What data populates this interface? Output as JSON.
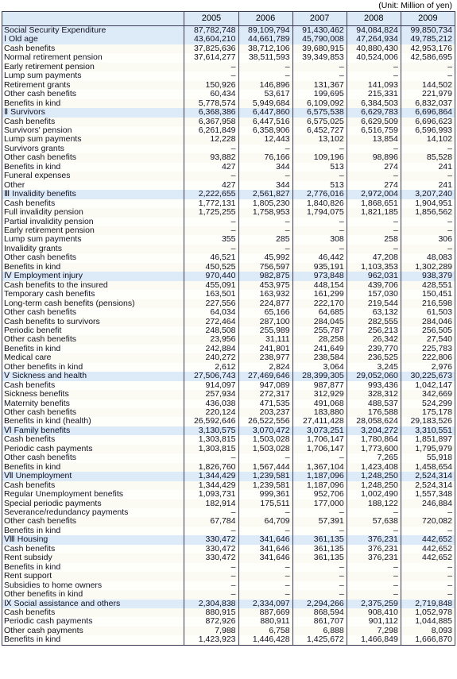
{
  "unit_note": "(Unit: Million of yen)",
  "table": {
    "label_header": "",
    "year_headers": [
      "2005",
      "2006",
      "2007",
      "2008",
      "2009"
    ],
    "rows": [
      {
        "label": "Social Security Expenditure",
        "indent": 0,
        "highlight": true,
        "values": [
          "87,782,748",
          "89,109,794",
          "91,430,462",
          "94,084,824",
          "99,850,734"
        ]
      },
      {
        "label": "Ⅰ Old age",
        "indent": 1,
        "highlight": true,
        "values": [
          "43,604,210",
          "44,661,789",
          "45,790,008",
          "47,264,934",
          "49,785,212"
        ]
      },
      {
        "label": "Cash benefits",
        "indent": 2,
        "highlight": false,
        "values": [
          "37,825,636",
          "38,712,106",
          "39,680,915",
          "40,880,430",
          "42,953,176"
        ]
      },
      {
        "label": "Normal retirement pension",
        "indent": 3,
        "highlight": false,
        "values": [
          "37,614,277",
          "38,511,593",
          "39,349,853",
          "40,524,006",
          "42,586,695"
        ]
      },
      {
        "label": "Early retirement pension",
        "indent": 3,
        "highlight": false,
        "values": [
          "–",
          "–",
          "–",
          "–",
          "–"
        ]
      },
      {
        "label": "Lump sum payments",
        "indent": 3,
        "highlight": false,
        "values": [
          "–",
          "–",
          "–",
          "–",
          "–"
        ]
      },
      {
        "label": "Retirement grants",
        "indent": 3,
        "highlight": false,
        "values": [
          "150,926",
          "146,896",
          "131,367",
          "141,093",
          "144,502"
        ]
      },
      {
        "label": "Other cash benefits",
        "indent": 3,
        "highlight": false,
        "values": [
          "60,434",
          "53,617",
          "199,695",
          "215,331",
          "221,979"
        ]
      },
      {
        "label": "Benefits in kind",
        "indent": 2,
        "highlight": false,
        "values": [
          "5,778,574",
          "5,949,684",
          "6,109,092",
          "6,384,503",
          "6,832,037"
        ]
      },
      {
        "label": "Ⅱ Survivors",
        "indent": 1,
        "highlight": true,
        "values": [
          "6,368,386",
          "6,447,860",
          "6,575,538",
          "6,629,783",
          "6,696,864"
        ]
      },
      {
        "label": "Cash benefits",
        "indent": 2,
        "highlight": false,
        "values": [
          "6,367,958",
          "6,447,516",
          "6,575,025",
          "6,629,509",
          "6,696,623"
        ]
      },
      {
        "label": "Survivors' pension",
        "indent": 3,
        "highlight": false,
        "values": [
          "6,261,849",
          "6,358,906",
          "6,452,727",
          "6,516,759",
          "6,596,993"
        ]
      },
      {
        "label": "Lump sum payments",
        "indent": 3,
        "highlight": false,
        "values": [
          "12,228",
          "12,443",
          "13,102",
          "13,854",
          "14,102"
        ]
      },
      {
        "label": "Survivors grants",
        "indent": 3,
        "highlight": false,
        "values": [
          "–",
          "–",
          "–",
          "–",
          "–"
        ]
      },
      {
        "label": "Other cash benefits",
        "indent": 3,
        "highlight": false,
        "values": [
          "93,882",
          "76,166",
          "109,196",
          "98,896",
          "85,528"
        ]
      },
      {
        "label": "Benefits in kind",
        "indent": 2,
        "highlight": false,
        "values": [
          "427",
          "344",
          "513",
          "274",
          "241"
        ]
      },
      {
        "label": "Funeral expenses",
        "indent": 3,
        "highlight": false,
        "values": [
          "–",
          "–",
          "–",
          "–",
          "–"
        ]
      },
      {
        "label": "Other",
        "indent": 3,
        "highlight": false,
        "values": [
          "427",
          "344",
          "513",
          "274",
          "241"
        ]
      },
      {
        "label": "Ⅲ Invalidity benefits",
        "indent": 1,
        "highlight": true,
        "values": [
          "2,222,655",
          "2,561,827",
          "2,776,016",
          "2,972,004",
          "3,207,240"
        ]
      },
      {
        "label": "Cash benefits",
        "indent": 2,
        "highlight": false,
        "values": [
          "1,772,131",
          "1,805,230",
          "1,840,826",
          "1,868,651",
          "1,904,951"
        ]
      },
      {
        "label": "Full invalidity pension",
        "indent": 3,
        "highlight": false,
        "values": [
          "1,725,255",
          "1,758,953",
          "1,794,075",
          "1,821,185",
          "1,856,562"
        ]
      },
      {
        "label": "Partial invalidity pension",
        "indent": 3,
        "highlight": false,
        "values": [
          "–",
          "–",
          "–",
          "–",
          "–"
        ]
      },
      {
        "label": "Early retirement pension",
        "indent": 3,
        "highlight": false,
        "values": [
          "–",
          "–",
          "–",
          "–",
          "–"
        ]
      },
      {
        "label": "Lump sum payments",
        "indent": 3,
        "highlight": false,
        "values": [
          "355",
          "285",
          "308",
          "258",
          "306"
        ]
      },
      {
        "label": "Invalidity grants",
        "indent": 3,
        "highlight": false,
        "values": [
          "–",
          "–",
          "–",
          "–",
          "–"
        ]
      },
      {
        "label": "Other cash benefits",
        "indent": 3,
        "highlight": false,
        "values": [
          "46,521",
          "45,992",
          "46,442",
          "47,208",
          "48,083"
        ]
      },
      {
        "label": "Benefits in kind",
        "indent": 2,
        "highlight": false,
        "values": [
          "450,525",
          "756,597",
          "935,191",
          "1,103,353",
          "1,302,289"
        ]
      },
      {
        "label": "Ⅳ Employment injury",
        "indent": 1,
        "highlight": true,
        "values": [
          "970,440",
          "982,875",
          "973,848",
          "962,031",
          "938,379"
        ]
      },
      {
        "label": "Cash benefits to the insured",
        "indent": 2,
        "highlight": false,
        "values": [
          "455,091",
          "453,975",
          "448,154",
          "439,706",
          "428,551"
        ]
      },
      {
        "label": "Temporary cash benefits",
        "indent": 3,
        "highlight": false,
        "values": [
          "163,501",
          "163,932",
          "161,299",
          "157,030",
          "150,451"
        ]
      },
      {
        "label": "Long-term cash benefits (pensions)",
        "indent": 3,
        "highlight": false,
        "values": [
          "227,556",
          "224,877",
          "222,170",
          "219,544",
          "216,598"
        ]
      },
      {
        "label": "Other cash benefits",
        "indent": 3,
        "highlight": false,
        "values": [
          "64,034",
          "65,166",
          "64,685",
          "63,132",
          "61,503"
        ]
      },
      {
        "label": "Cash benefits to survivors",
        "indent": 2,
        "highlight": false,
        "values": [
          "272,464",
          "287,100",
          "284,045",
          "282,555",
          "284,046"
        ]
      },
      {
        "label": "Periodic benefit",
        "indent": 3,
        "highlight": false,
        "values": [
          "248,508",
          "255,989",
          "255,787",
          "256,213",
          "256,505"
        ]
      },
      {
        "label": "Other cash benefits",
        "indent": 3,
        "highlight": false,
        "values": [
          "23,956",
          "31,111",
          "28,258",
          "26,342",
          "27,540"
        ]
      },
      {
        "label": "Benefits in kind",
        "indent": 2,
        "highlight": false,
        "values": [
          "242,884",
          "241,801",
          "241,649",
          "239,770",
          "225,783"
        ]
      },
      {
        "label": "Medical care",
        "indent": 3,
        "highlight": false,
        "values": [
          "240,272",
          "238,977",
          "238,584",
          "236,525",
          "222,806"
        ]
      },
      {
        "label": "Other benefits in kind",
        "indent": 3,
        "highlight": false,
        "values": [
          "2,612",
          "2,824",
          "3,064",
          "3,245",
          "2,976"
        ]
      },
      {
        "label": "Ⅴ Sickness and health",
        "indent": 1,
        "highlight": true,
        "values": [
          "27,506,743",
          "27,469,646",
          "28,399,305",
          "29,052,060",
          "30,225,673"
        ]
      },
      {
        "label": "Cash benefits",
        "indent": 2,
        "highlight": false,
        "values": [
          "914,097",
          "947,089",
          "987,877",
          "993,436",
          "1,042,147"
        ]
      },
      {
        "label": "Sickness benefits",
        "indent": 3,
        "highlight": false,
        "values": [
          "257,934",
          "272,317",
          "312,929",
          "328,312",
          "342,669"
        ]
      },
      {
        "label": "Maternity benefits",
        "indent": 3,
        "highlight": false,
        "values": [
          "436,038",
          "471,535",
          "491,068",
          "488,537",
          "524,299"
        ]
      },
      {
        "label": "Other cash benefits",
        "indent": 3,
        "highlight": false,
        "values": [
          "220,124",
          "203,237",
          "183,880",
          "176,588",
          "175,178"
        ]
      },
      {
        "label": "Benefits in kind (health)",
        "indent": 2,
        "highlight": false,
        "values": [
          "26,592,646",
          "26,522,556",
          "27,411,428",
          "28,058,624",
          "29,183,526"
        ]
      },
      {
        "label": "Ⅵ Family benefits",
        "indent": 1,
        "highlight": true,
        "values": [
          "3,130,575",
          "3,070,472",
          "3,073,251",
          "3,204,272",
          "3,310,551"
        ]
      },
      {
        "label": "Cash benefits",
        "indent": 2,
        "highlight": false,
        "values": [
          "1,303,815",
          "1,503,028",
          "1,706,147",
          "1,780,864",
          "1,851,897"
        ]
      },
      {
        "label": "Periodic cash payments",
        "indent": 3,
        "highlight": false,
        "values": [
          "1,303,815",
          "1,503,028",
          "1,706,147",
          "1,773,600",
          "1,795,979"
        ]
      },
      {
        "label": "Other cash benefits",
        "indent": 3,
        "highlight": false,
        "values": [
          "–",
          "–",
          "–",
          "7,265",
          "55,918"
        ]
      },
      {
        "label": "Benefits in kind",
        "indent": 2,
        "highlight": false,
        "values": [
          "1,826,760",
          "1,567,444",
          "1,367,104",
          "1,423,408",
          "1,458,654"
        ]
      },
      {
        "label": "Ⅶ Unemployment",
        "indent": 1,
        "highlight": true,
        "values": [
          "1,344,429",
          "1,239,581",
          "1,187,096",
          "1,248,250",
          "2,524,314"
        ]
      },
      {
        "label": "Cash benefits",
        "indent": 2,
        "highlight": false,
        "values": [
          "1,344,429",
          "1,239,581",
          "1,187,096",
          "1,248,250",
          "2,524,314"
        ]
      },
      {
        "label": "Regular Unemployment benefits",
        "indent": 3,
        "highlight": false,
        "values": [
          "1,093,731",
          "999,361",
          "952,706",
          "1,002,490",
          "1,557,348"
        ]
      },
      {
        "label": "Special periodic payments",
        "indent": 3,
        "highlight": false,
        "values": [
          "182,914",
          "175,511",
          "177,000",
          "188,122",
          "246,884"
        ]
      },
      {
        "label": "Severance/redundancy payments",
        "indent": 3,
        "highlight": false,
        "values": [
          "–",
          "–",
          "–",
          "–",
          "–"
        ]
      },
      {
        "label": "Other cash benefits",
        "indent": 3,
        "highlight": false,
        "values": [
          "67,784",
          "64,709",
          "57,391",
          "57,638",
          "720,082"
        ]
      },
      {
        "label": "Benefits in kind",
        "indent": 2,
        "highlight": false,
        "values": [
          "–",
          "–",
          "–",
          "–",
          "–"
        ]
      },
      {
        "label": "Ⅷ Housing",
        "indent": 1,
        "highlight": true,
        "values": [
          "330,472",
          "341,646",
          "361,135",
          "376,231",
          "442,652"
        ]
      },
      {
        "label": "Cash benefits",
        "indent": 2,
        "highlight": false,
        "values": [
          "330,472",
          "341,646",
          "361,135",
          "376,231",
          "442,652"
        ]
      },
      {
        "label": "Rent subsidy",
        "indent": 3,
        "highlight": false,
        "values": [
          "330,472",
          "341,646",
          "361,135",
          "376,231",
          "442,652"
        ]
      },
      {
        "label": "Benefits in kind",
        "indent": 2,
        "highlight": false,
        "values": [
          "–",
          "–",
          "–",
          "–",
          "–"
        ]
      },
      {
        "label": "Rent support",
        "indent": 3,
        "highlight": false,
        "values": [
          "–",
          "–",
          "–",
          "–",
          "–"
        ]
      },
      {
        "label": "Subsidies to home owners",
        "indent": 3,
        "highlight": false,
        "values": [
          "–",
          "–",
          "–",
          "–",
          "–"
        ]
      },
      {
        "label": "Other benefits in kind",
        "indent": 3,
        "highlight": false,
        "values": [
          "–",
          "–",
          "–",
          "–",
          "–"
        ]
      },
      {
        "label": "Ⅸ Social assistance and others",
        "indent": 1,
        "highlight": true,
        "values": [
          "2,304,838",
          "2,334,097",
          "2,294,266",
          "2,375,259",
          "2,719,848"
        ]
      },
      {
        "label": "Cash benefits",
        "indent": 2,
        "highlight": false,
        "values": [
          "880,915",
          "887,669",
          "868,594",
          "908,410",
          "1,052,978"
        ]
      },
      {
        "label": "Periodic cash payments",
        "indent": 3,
        "highlight": false,
        "values": [
          "872,926",
          "880,911",
          "861,707",
          "901,112",
          "1,044,885"
        ]
      },
      {
        "label": "Other cash payments",
        "indent": 3,
        "highlight": false,
        "values": [
          "7,988",
          "6,758",
          "6,888",
          "7,298",
          "8,093"
        ]
      },
      {
        "label": "Benefits in kind",
        "indent": 2,
        "highlight": false,
        "values": [
          "1,423,923",
          "1,446,428",
          "1,425,672",
          "1,466,849",
          "1,666,870"
        ]
      }
    ]
  }
}
